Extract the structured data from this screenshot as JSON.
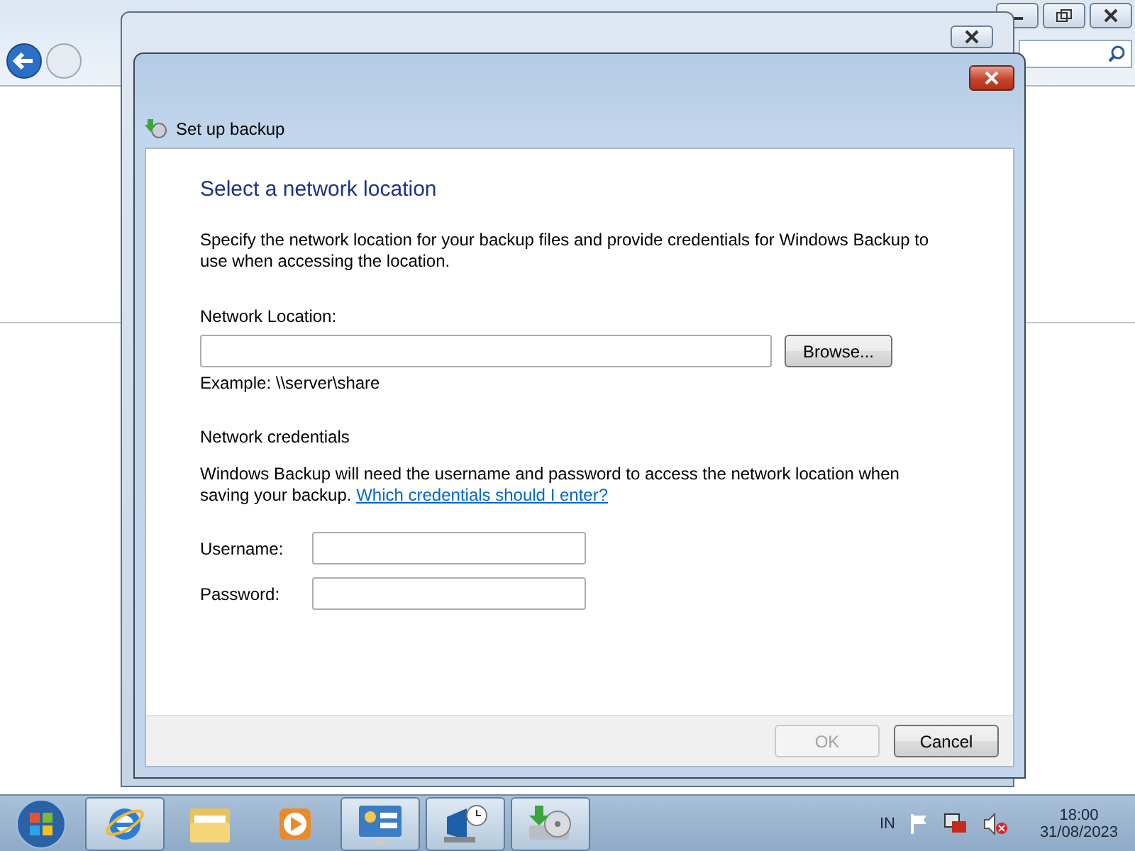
{
  "dialog": {
    "title": "Set up backup",
    "heading": "Select a network location",
    "intro": "Specify the network location for your backup files and provide credentials for Windows Backup to use when accessing the location.",
    "location_label": "Network Location:",
    "browse": "Browse...",
    "example": "Example: \\\\server\\share",
    "credentials_heading": "Network credentials",
    "credentials_text": "Windows Backup will need the username and password to access the network location when saving your backup.",
    "credentials_link": "Which credentials should I enter?",
    "fields": [
      {
        "label": "Username:"
      },
      {
        "label": "Password:"
      }
    ],
    "buttons": [
      {
        "label": "OK",
        "disabled": true
      },
      {
        "label": "Cancel",
        "disabled": false
      }
    ]
  },
  "taskbar": {
    "items": [
      {
        "kind": "browser",
        "running": true
      },
      {
        "kind": "folder",
        "running": false
      },
      {
        "kind": "media",
        "running": false
      },
      {
        "kind": "control",
        "running": true
      },
      {
        "kind": "network",
        "running": true
      },
      {
        "kind": "backup",
        "running": true
      }
    ],
    "language": "IN",
    "time": "18:00",
    "date": "31/08/2023"
  }
}
